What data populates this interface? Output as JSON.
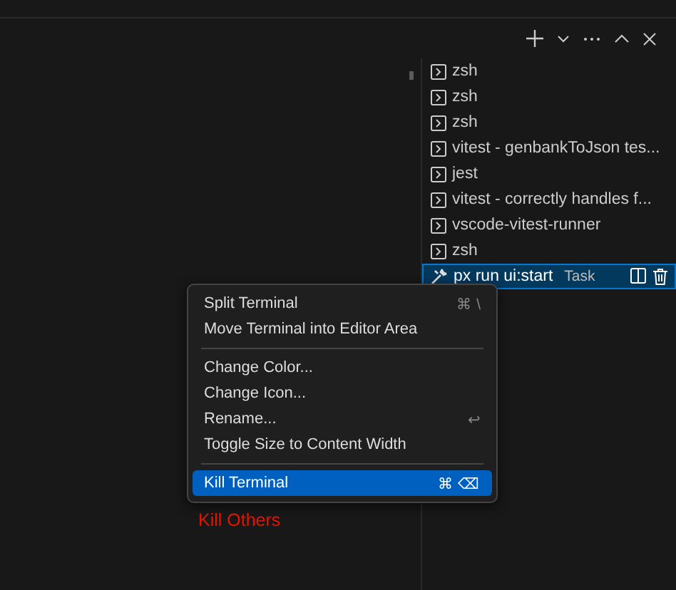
{
  "toolbar": {
    "buttons": [
      {
        "kind": "add"
      },
      {
        "kind": "dropdown"
      },
      {
        "kind": "more"
      },
      {
        "kind": "maximize"
      },
      {
        "kind": "close"
      }
    ]
  },
  "terminals": [
    {
      "label": "zsh",
      "selected": false,
      "kind": "shell"
    },
    {
      "label": "zsh",
      "selected": false,
      "kind": "shell"
    },
    {
      "label": "zsh",
      "selected": false,
      "kind": "shell"
    },
    {
      "label": "vitest - genbankToJson tes...",
      "selected": false,
      "kind": "shell"
    },
    {
      "label": "jest",
      "selected": false,
      "kind": "shell"
    },
    {
      "label": "vitest - correctly handles f...",
      "selected": false,
      "kind": "shell"
    },
    {
      "label": "vscode-vitest-runner",
      "selected": false,
      "kind": "shell"
    },
    {
      "label": "zsh",
      "selected": false,
      "kind": "shell"
    },
    {
      "label": "px run ui:start",
      "badge": "Task",
      "selected": true,
      "kind": "task"
    }
  ],
  "context_menu": {
    "items": [
      {
        "kind": "item",
        "label": "Split Terminal",
        "shortcut": "⌘ \\",
        "selected": false
      },
      {
        "kind": "item",
        "label": "Move Terminal into Editor Area",
        "selected": false
      },
      {
        "kind": "separator"
      },
      {
        "kind": "item",
        "label": "Change Color...",
        "selected": false
      },
      {
        "kind": "item",
        "label": "Change Icon...",
        "selected": false
      },
      {
        "kind": "item",
        "label": "Rename...",
        "shortcut": "↩",
        "selected": false
      },
      {
        "kind": "item",
        "label": "Toggle Size to Content Width",
        "selected": false
      },
      {
        "kind": "separator"
      },
      {
        "kind": "item",
        "label": "Kill Terminal",
        "shortcut": "⌘ ⌫",
        "selected": true
      }
    ]
  },
  "annotation": "Kill Others"
}
